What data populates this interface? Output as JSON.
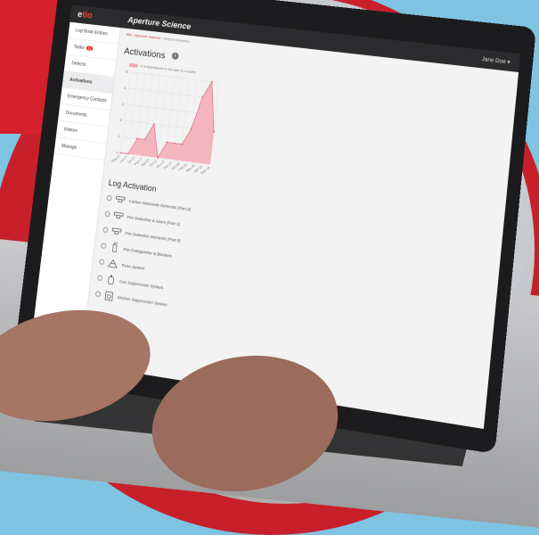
{
  "app": {
    "logo_prefix": "e",
    "logo_text": "tio",
    "title": "Aperture Science",
    "user_label": "Jane Doe"
  },
  "breadcrumb": {
    "first": "Site",
    "second": "Aperture Science",
    "current": "Report Activation"
  },
  "sidebar": {
    "items": [
      {
        "label": "Log Book Entries"
      },
      {
        "label": "Tasks",
        "badge": "11"
      },
      {
        "label": "Defects"
      },
      {
        "label": "Activations"
      },
      {
        "label": "Emergency Contacts"
      },
      {
        "label": "Documents"
      },
      {
        "label": "Visitors"
      },
      {
        "label": "Manage"
      }
    ]
  },
  "main": {
    "title": "Activations",
    "log_title": "Log Activation",
    "log_items": [
      {
        "label": "Carbon Monoxide Domestic (Part 4)",
        "icon": "smoke-detector-icon"
      },
      {
        "label": "Fire Detection & Alarm (Part 1)",
        "icon": "smoke-detector-icon"
      },
      {
        "label": "Fire Detection Domestic (Part 6)",
        "icon": "smoke-detector-icon"
      },
      {
        "label": "Fire Extinguisher & Blankets",
        "icon": "extinguisher-icon"
      },
      {
        "label": "Truss System",
        "icon": "truss-icon"
      },
      {
        "label": "Gas Suppression System",
        "icon": "gas-cylinder-icon"
      },
      {
        "label": "Kitchen Suppression System",
        "icon": "kitchen-icon"
      }
    ]
  },
  "chart_data": {
    "type": "area",
    "title": "",
    "legend": [
      "# of Activations in the last 12 months"
    ],
    "categories": [
      "May-17",
      "Jun-17",
      "Jul-17",
      "Aug-17",
      "Sep-17",
      "Oct-17",
      "Nov-17",
      "Dec-17",
      "Jan-18",
      "Feb-18",
      "Mar-18",
      "Apr-18",
      "May-18"
    ],
    "series": [
      {
        "name": "# of Activations in the last 12 months",
        "values": [
          0,
          0,
          1,
          1,
          2,
          0,
          1,
          1,
          1,
          2,
          4,
          5,
          2
        ]
      }
    ],
    "ylim": [
      0,
      5
    ],
    "y_ticks": [
      0,
      1,
      2,
      3,
      4,
      5
    ],
    "grid": true,
    "colors": {
      "fill": "#f4a6b0",
      "line": "#e57386"
    }
  }
}
